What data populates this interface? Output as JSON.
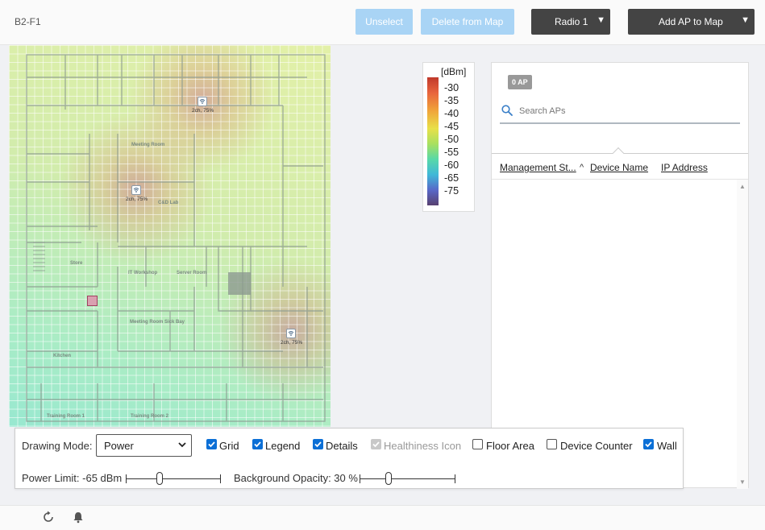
{
  "header": {
    "floor_name": "B2-F1",
    "unselect_label": "Unselect",
    "delete_label": "Delete from Map",
    "radio_label": "Radio 1",
    "add_ap_label": "Add AP to Map"
  },
  "map": {
    "rooms": [
      "Meeting Room",
      "C&D Lab",
      "Store",
      "IT Workshop",
      "Server Room",
      "Meeting Room",
      "Sick Bay",
      "Kitchen",
      "Training Room 1",
      "Training Room 2"
    ],
    "access_points": [
      {
        "label": "2ch, 75%",
        "icon": "wifi-icon"
      },
      {
        "label": "2ch, 75%",
        "icon": "wifi-icon"
      },
      {
        "label": "2ch, 75%",
        "icon": "wifi-icon"
      }
    ]
  },
  "legend": {
    "unit": "[dBm]",
    "ticks": [
      "-30",
      "-35",
      "-40",
      "-45",
      "-50",
      "-55",
      "-60",
      "-65",
      "-75"
    ],
    "colors": [
      "#c0392b",
      "#e8643c",
      "#f0a43a",
      "#e8e048",
      "#a8e060",
      "#58d8a8",
      "#40b8d8",
      "#5868c8",
      "#584070"
    ]
  },
  "panel": {
    "ap_count": "0 AP",
    "search_placeholder": "Search APs",
    "columns": [
      "Management St...",
      "Device Name",
      "IP Address"
    ],
    "sort_column": "Device Name",
    "sort_direction": "ascending"
  },
  "options": {
    "drawing_mode_label": "Drawing Mode:",
    "drawing_mode_value": "Power",
    "checkboxes": [
      {
        "label": "Grid",
        "checked": true,
        "disabled": false
      },
      {
        "label": "Legend",
        "checked": true,
        "disabled": false
      },
      {
        "label": "Details",
        "checked": true,
        "disabled": false
      },
      {
        "label": "Healthiness Icon",
        "checked": true,
        "disabled": true
      },
      {
        "label": "Floor Area",
        "checked": false,
        "disabled": false
      },
      {
        "label": "Device Counter",
        "checked": false,
        "disabled": false
      },
      {
        "label": "Wall",
        "checked": true,
        "disabled": false
      }
    ],
    "power_limit_label": "Power Limit: -65 dBm",
    "power_limit_fraction": 0.36,
    "background_opacity_label": "Background Opacity: 30 %",
    "background_opacity_fraction": 0.3
  },
  "footer": {
    "icons": [
      "refresh-icon",
      "bell-icon"
    ]
  },
  "colors": {
    "accent_blue": "#0b6fd6",
    "button_light": "#a9d4f5",
    "button_dark": "#444444"
  }
}
